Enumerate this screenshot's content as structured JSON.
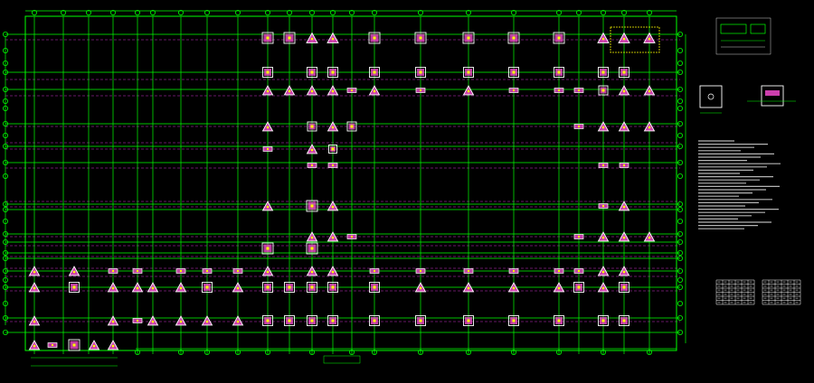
{
  "drawing": {
    "background": "#000000",
    "colors": {
      "grid_line": "#00ff00",
      "section_line": "#cc33cc",
      "footing": "#ff4fd8",
      "footing_outline": "#ffffff",
      "column": "#ffff00",
      "axis_bubble": "#00ff00",
      "dimension": "#00ff00",
      "notes_text": "#ffffff",
      "highlight_box": "#ffff00"
    },
    "plan_title": "",
    "notes_heading": "",
    "detail_labels": [
      "",
      ""
    ],
    "icons": [
      "grid-axis-bubble",
      "square-footing",
      "triangular-pile-cap",
      "column-marker"
    ]
  }
}
